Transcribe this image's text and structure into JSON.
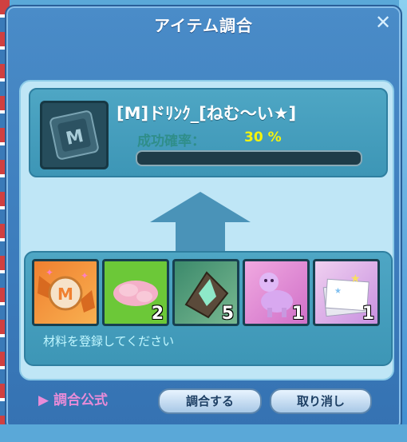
{
  "window": {
    "title": "アイテム調合",
    "close_label": "✕"
  },
  "result": {
    "item_name": "[M]ドﾘﾝｸ_[ねむ～い★]",
    "rate_label": "成功確率：",
    "rate_value": "30 %",
    "progress_fraction": 0
  },
  "materials": {
    "slots": [
      {
        "name": "material-slot-1",
        "icon": "candy-m-icon",
        "count": ""
      },
      {
        "name": "material-slot-2",
        "icon": "pink-fluff-icon",
        "count": "2"
      },
      {
        "name": "material-slot-3",
        "icon": "crystal-icon",
        "count": "5"
      },
      {
        "name": "material-slot-4",
        "icon": "alpaca-icon",
        "count": "1"
      },
      {
        "name": "material-slot-5",
        "icon": "paper-stack-icon",
        "count": "1"
      }
    ],
    "hint": "材料を登録してください"
  },
  "footer": {
    "formula_label": "▶ 調合公式",
    "combine_label": "調合する",
    "cancel_label": "取り消し"
  },
  "colors": {
    "accent": "#e88cd8",
    "rate": "#f4f40c"
  }
}
